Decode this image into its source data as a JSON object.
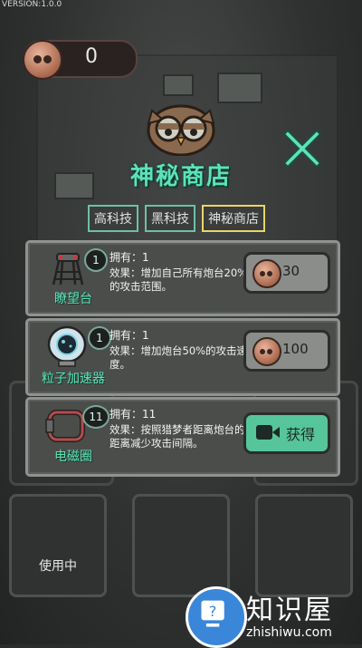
{
  "version": "VERSION:1.0.0",
  "currency": {
    "icon": "coin-icon",
    "value": "0"
  },
  "title": "神秘商店",
  "tabs": [
    {
      "label": "高科技",
      "active": false
    },
    {
      "label": "黑科技",
      "active": false
    },
    {
      "label": "神秘商店",
      "active": true
    }
  ],
  "items": [
    {
      "name": "瞭望台",
      "count": "1",
      "owned": "拥有：1",
      "effect": "效果：增加自己所有炮台20%的攻击范围。",
      "button": {
        "type": "coin",
        "price": "30"
      }
    },
    {
      "name": "粒子加速器",
      "count": "1",
      "owned": "拥有：1",
      "effect": "效果：增加炮台50%的攻击速度。",
      "button": {
        "type": "coin",
        "price": "100"
      }
    },
    {
      "name": "电磁圈",
      "count": "11",
      "owned": "拥有：11",
      "effect": "效果：按照猎梦者距离炮台的距离减少攻击间隔。",
      "button": {
        "type": "video",
        "label": "获得"
      }
    }
  ],
  "background_slots": {
    "in_use_label": "使用中"
  },
  "watermark": {
    "text": "知识屋",
    "sub": "zhishiwu.com"
  },
  "colors": {
    "accent": "#5de2b8",
    "active_tab": "#e9d56b"
  }
}
